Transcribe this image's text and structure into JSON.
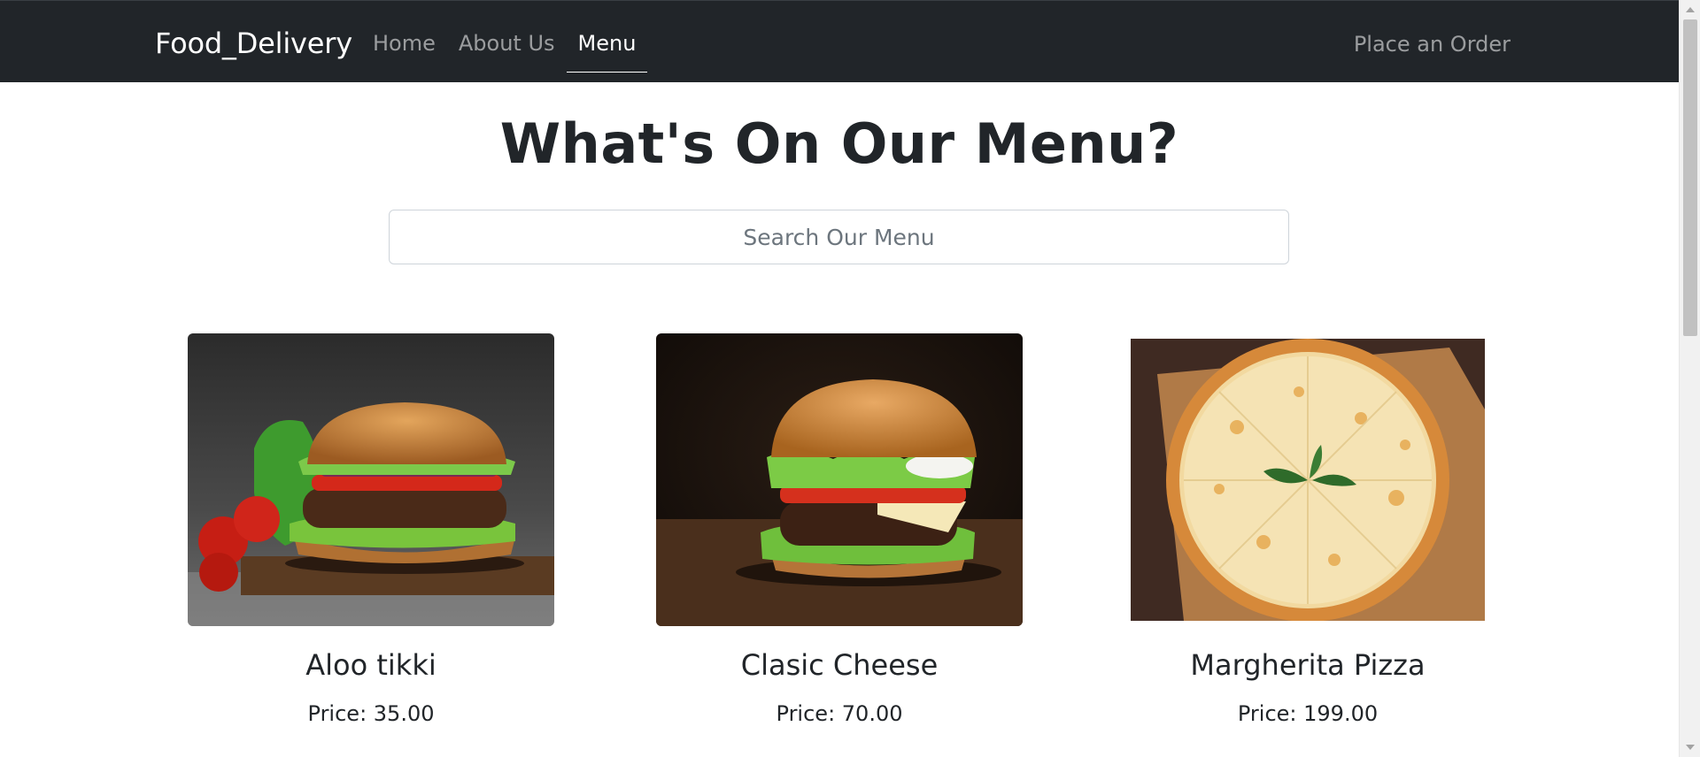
{
  "navbar": {
    "brand": "Food_Delivery",
    "links": [
      {
        "label": "Home",
        "active": false
      },
      {
        "label": "About Us",
        "active": false
      },
      {
        "label": "Menu",
        "active": true
      }
    ],
    "order_link": "Place an Order"
  },
  "main": {
    "title": "What's On Our Menu?",
    "search": {
      "placeholder": "Search Our Menu",
      "value": ""
    },
    "items": [
      {
        "name": "Aloo tikki",
        "price": "Price: 35.00",
        "image": "burger-photo"
      },
      {
        "name": "Clasic Cheese",
        "price": "Price: 70.00",
        "image": "cheeseburger-photo"
      },
      {
        "name": "Margherita Pizza",
        "price": "Price: 199.00",
        "image": "pizza-photo"
      }
    ]
  },
  "colors": {
    "navbar_bg": "#212529",
    "text": "#212529",
    "muted_link": "rgba(255,255,255,0.55)"
  }
}
